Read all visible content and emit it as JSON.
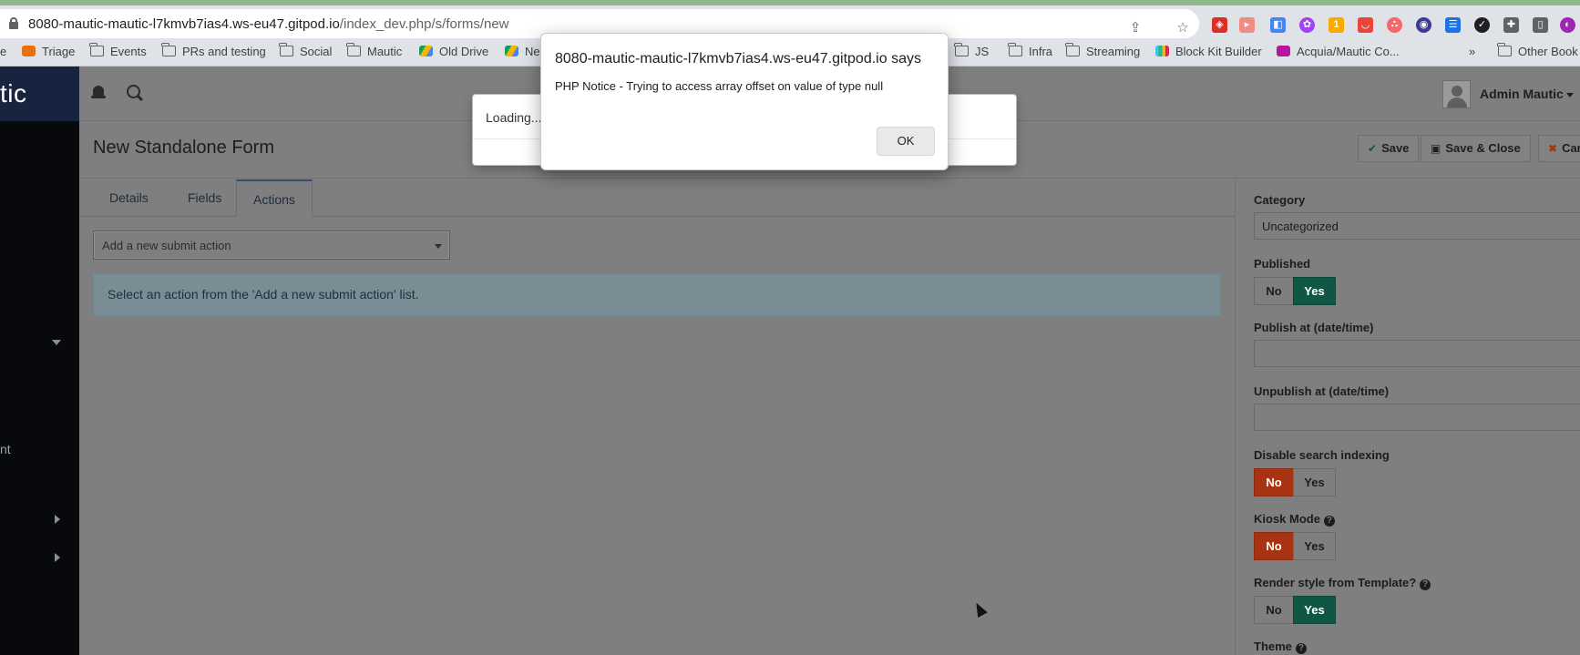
{
  "browser": {
    "url_host": "8080-mautic-mautic-l7kmvb7ias4.ws-eu47.gitpod.io",
    "url_path": "/index_dev.php/s/forms/new",
    "bookmarks": [
      {
        "label": "e"
      },
      {
        "label": "Triage"
      },
      {
        "label": "Events"
      },
      {
        "label": "PRs and testing"
      },
      {
        "label": "Social"
      },
      {
        "label": "Mautic"
      },
      {
        "label": "Old Drive"
      },
      {
        "label": "Ne"
      },
      {
        "label": "JS"
      },
      {
        "label": "Infra"
      },
      {
        "label": "Streaming"
      },
      {
        "label": "Block Kit Builder"
      },
      {
        "label": "Acquia/Mautic Co..."
      },
      {
        "label": "Other Book"
      }
    ],
    "overflow_label": "»",
    "extension_badge": "1"
  },
  "app": {
    "brand": "tic",
    "sidebar_fragment": "nt",
    "user_name": "Admin Mautic"
  },
  "page": {
    "title": "New Standalone Form",
    "buttons": {
      "save": "Save",
      "save_close": "Save & Close",
      "cancel": "Canc"
    },
    "tabs": [
      "Details",
      "Fields",
      "Actions"
    ],
    "active_tab": "Actions",
    "submit_action_placeholder": "Add a new submit action",
    "info_message": "Select an action from the 'Add a new submit action' list."
  },
  "panel": {
    "category_label": "Category",
    "category_value": "Uncategorized",
    "published_label": "Published",
    "publish_at_label": "Publish at (date/time)",
    "unpublish_at_label": "Unpublish at (date/time)",
    "disable_search_label": "Disable search indexing",
    "kiosk_label": "Kiosk Mode",
    "render_style_label": "Render style from Template?",
    "theme_label": "Theme",
    "no": "No",
    "yes": "Yes"
  },
  "loading_modal": {
    "text": "Loading..."
  },
  "alert": {
    "title": "8080-mautic-mautic-l7kmvb7ias4.ws-eu47.gitpod.io says",
    "message": "PHP Notice - Trying to access array offset on value of type null",
    "ok_label": "OK"
  },
  "colors": {
    "toggle_green": "#0f5645",
    "toggle_red": "#a83313",
    "brand_blue": "#18233f"
  }
}
